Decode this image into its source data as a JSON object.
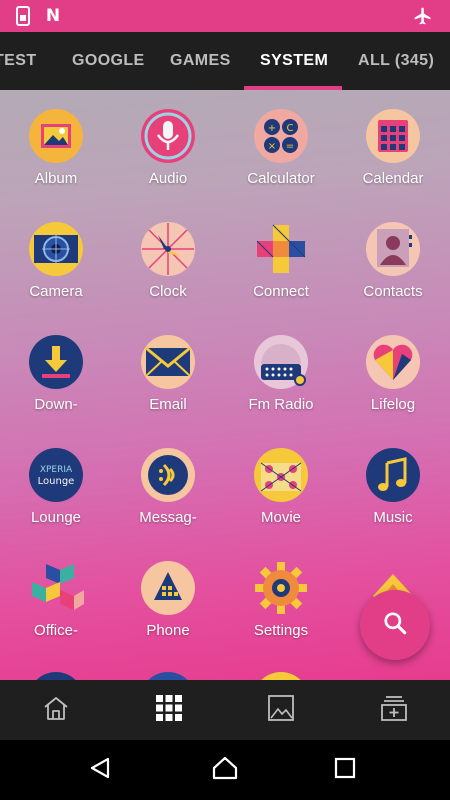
{
  "colors": {
    "accent": "#e13e87",
    "tab_bar": "#1f1f1f",
    "dock": "#1f1f1f",
    "nav_bar": "#000000",
    "icon_blue": "#1e3a7a",
    "icon_yellow": "#f5c93a"
  },
  "status_bar": {
    "left_icons": [
      "storage-card-icon",
      "n-letter-icon"
    ],
    "n_glyph": "N",
    "right_icons": [
      "airplane-mode-icon"
    ]
  },
  "tabs": [
    {
      "label": "TEST",
      "active": false
    },
    {
      "label": "GOOGLE",
      "active": false
    },
    {
      "label": "GAMES",
      "active": false
    },
    {
      "label": "SYSTEM",
      "active": true
    },
    {
      "label": "ALL (345)",
      "active": false
    }
  ],
  "apps": [
    {
      "label": "Album",
      "icon": "album-icon"
    },
    {
      "label": "Audio",
      "icon": "microphone-icon"
    },
    {
      "label": "Calculator",
      "icon": "calculator-icon"
    },
    {
      "label": "Calendar",
      "icon": "calendar-icon"
    },
    {
      "label": "Camera",
      "icon": "camera-icon"
    },
    {
      "label": "Clock",
      "icon": "clock-icon"
    },
    {
      "label": "Connect",
      "icon": "connect-icon"
    },
    {
      "label": "Contacts",
      "icon": "contacts-icon"
    },
    {
      "label": "Down-",
      "icon": "download-icon"
    },
    {
      "label": "Email",
      "icon": "email-icon"
    },
    {
      "label": "Fm Radio",
      "icon": "radio-icon"
    },
    {
      "label": "Lifelog",
      "icon": "heart-icon"
    },
    {
      "label": "Lounge",
      "icon": "xperia-lounge-icon",
      "icon_text": [
        "XPERIA",
        "Lounge"
      ]
    },
    {
      "label": "Messag-",
      "icon": "message-icon"
    },
    {
      "label": "Movie",
      "icon": "movie-icon"
    },
    {
      "label": "Music",
      "icon": "music-note-icon"
    },
    {
      "label": "Office-",
      "icon": "office-cube-icon"
    },
    {
      "label": "Phone",
      "icon": "phone-icon"
    },
    {
      "label": "Settings",
      "icon": "gear-icon"
    },
    {
      "label": "",
      "icon": "partial-app-icon"
    }
  ],
  "fab": {
    "icon": "search-icon"
  },
  "dock": [
    {
      "icon": "home-icon"
    },
    {
      "icon": "apps-grid-icon"
    },
    {
      "icon": "gallery-icon"
    },
    {
      "icon": "add-widget-icon"
    }
  ],
  "navbar": [
    {
      "icon": "back-icon"
    },
    {
      "icon": "home-nav-icon"
    },
    {
      "icon": "recents-icon"
    }
  ]
}
